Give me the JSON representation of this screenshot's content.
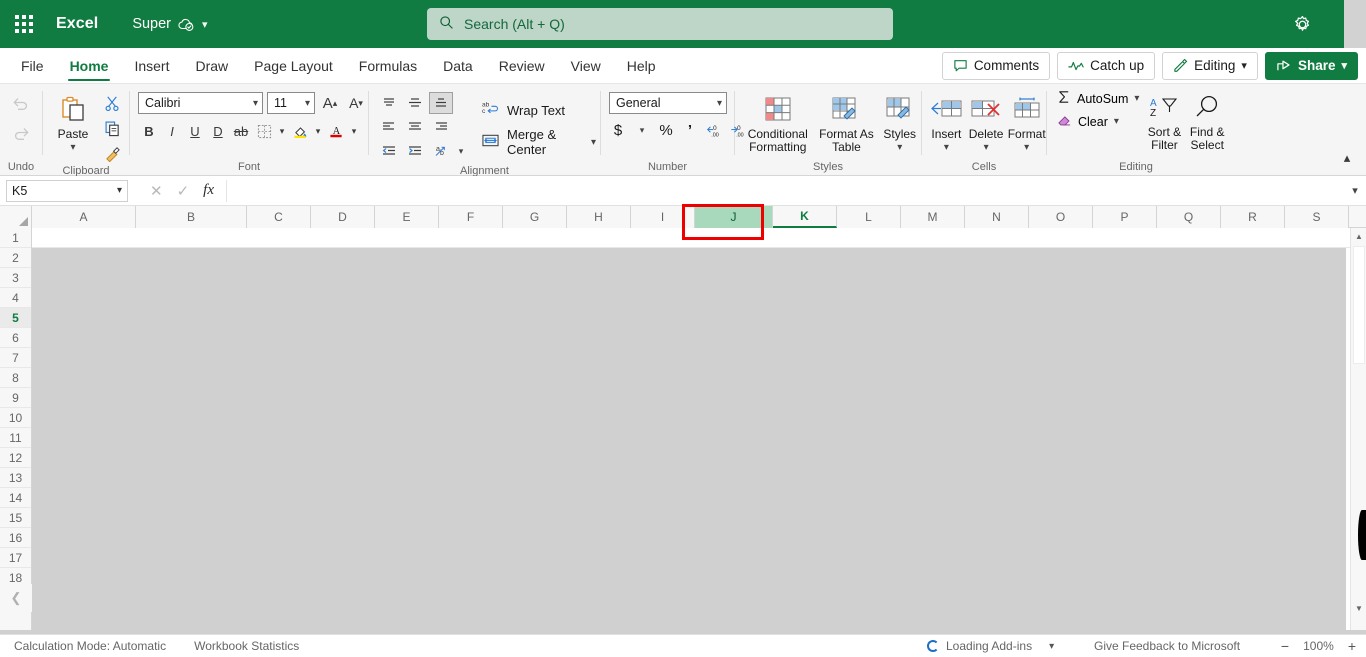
{
  "titlebar": {
    "app_waffle_icon": "app-launcher-icon",
    "app_title": "Excel",
    "doc_name": "Super",
    "cloud_icon": "cloud-saved-icon",
    "doc_chevron": "chevron-down-icon",
    "settings_icon": "gear-icon",
    "brand_color": "#107c41"
  },
  "search": {
    "icon": "search-icon",
    "placeholder": "Search (Alt + Q)"
  },
  "ribbon_tabs": [
    {
      "label": "File",
      "active": false
    },
    {
      "label": "Home",
      "active": true
    },
    {
      "label": "Insert",
      "active": false
    },
    {
      "label": "Draw",
      "active": false
    },
    {
      "label": "Page Layout",
      "active": false
    },
    {
      "label": "Formulas",
      "active": false
    },
    {
      "label": "Data",
      "active": false
    },
    {
      "label": "Review",
      "active": false
    },
    {
      "label": "View",
      "active": false
    },
    {
      "label": "Help",
      "active": false
    }
  ],
  "tabrow_right": {
    "comments": "Comments",
    "comments_icon": "comment-icon",
    "catch_up": "Catch up",
    "catch_up_icon": "activity-line-icon",
    "editing": "Editing",
    "editing_icon": "pencil-icon",
    "editing_chevron": "chevron-down-icon",
    "share": "Share",
    "share_icon": "share-arrow-icon",
    "share_chevron": "chevron-down-icon"
  },
  "ribbon": {
    "groups": [
      {
        "label": "Undo"
      },
      {
        "label": "Clipboard"
      },
      {
        "label": "Font"
      },
      {
        "label": "Alignment"
      },
      {
        "label": "Number"
      },
      {
        "label": "Styles"
      },
      {
        "label": "Cells"
      },
      {
        "label": "Editing"
      }
    ],
    "undo": {
      "undo_icon": "undo-icon",
      "redo_icon": "redo-icon"
    },
    "clipboard": {
      "paste_label": "Paste",
      "paste_icon": "paste-icon",
      "paste_chevron": "chevron-down-icon",
      "cut_icon": "scissors-icon",
      "copy_icon": "copy-icon",
      "format_painter_icon": "format-painter-icon"
    },
    "font": {
      "font_family_value": "Calibri",
      "font_size_value": "11",
      "grow_font_icon": "increase-font-size-icon",
      "shrink_font_icon": "decrease-font-size-icon",
      "bold": "B",
      "italic": "I",
      "underline": "U",
      "double_underline": "D",
      "strikethrough": "ab",
      "borders_icon": "borders-icon",
      "fill_color_icon": "fill-color-icon",
      "font_color_icon": "font-color-icon",
      "fill_color_swatch": "#ffe600",
      "font_color_swatch": "#e00000"
    },
    "alignment": {
      "align_top_icon": "align-top-icon",
      "align_middle_icon": "align-middle-icon",
      "align_bottom_icon": "align-bottom-icon",
      "align_left_icon": "align-left-icon",
      "align_center_icon": "align-center-icon",
      "align_right_icon": "align-right-icon",
      "decrease_indent_icon": "decrease-indent-icon",
      "increase_indent_icon": "increase-indent-icon",
      "orientation_icon": "text-orientation-icon",
      "wrap_text": "Wrap Text",
      "wrap_text_icon": "wrap-text-icon",
      "merge_center": "Merge & Center",
      "merge_center_icon": "merge-cells-icon",
      "merge_chevron": "chevron-down-icon"
    },
    "number": {
      "format_value": "General",
      "currency_icon": "currency-icon",
      "currency_chevron": "chevron-down-icon",
      "percent_icon": "percent-icon",
      "comma_icon": "comma-style-icon",
      "increase_decimal_icon": "increase-decimal-icon",
      "decrease_decimal_icon": "decrease-decimal-icon"
    },
    "styles": {
      "conditional_formatting": "Conditional Formatting",
      "conditional_formatting_icon": "conditional-formatting-icon",
      "format_as_table": "Format As Table",
      "format_as_table_icon": "format-as-table-icon",
      "styles": "Styles",
      "styles_icon": "cell-styles-icon"
    },
    "cells": {
      "insert": "Insert",
      "insert_icon": "insert-cells-icon",
      "delete": "Delete",
      "delete_icon": "delete-cells-icon",
      "format": "Format",
      "format_icon": "format-cells-icon"
    },
    "editing": {
      "autosum": "AutoSum",
      "autosum_icon": "sigma-icon",
      "clear": "Clear",
      "clear_icon": "eraser-icon",
      "sort_filter": "Sort & Filter",
      "sort_filter_icon": "sort-filter-icon",
      "find_select": "Find & Select",
      "find_select_icon": "magnifier-icon",
      "collapse_ribbon_icon": "chevron-up-icon"
    }
  },
  "formula_bar": {
    "name_box_value": "K5",
    "name_box_chevron": "chevron-down-icon",
    "cancel_icon": "close-icon",
    "confirm_icon": "check-icon",
    "function_icon": "fx-icon",
    "formula_value": "",
    "expand_chevron": "chevron-down-icon"
  },
  "grid": {
    "select_all_icon": "select-all-corner-icon",
    "columns": [
      {
        "label": "A",
        "width": 104
      },
      {
        "label": "B",
        "width": 111
      },
      {
        "label": "C",
        "width": 64
      },
      {
        "label": "D",
        "width": 64
      },
      {
        "label": "E",
        "width": 64
      },
      {
        "label": "F",
        "width": 64
      },
      {
        "label": "G",
        "width": 64
      },
      {
        "label": "H",
        "width": 64
      },
      {
        "label": "I",
        "width": 64
      },
      {
        "label": "J",
        "width": 78,
        "hovered": true
      },
      {
        "label": "K",
        "width": 64,
        "current": true
      },
      {
        "label": "L",
        "width": 64
      },
      {
        "label": "M",
        "width": 64
      },
      {
        "label": "N",
        "width": 64
      },
      {
        "label": "O",
        "width": 64
      },
      {
        "label": "P",
        "width": 64
      },
      {
        "label": "Q",
        "width": 64
      },
      {
        "label": "R",
        "width": 64
      },
      {
        "label": "S",
        "width": 64
      }
    ],
    "rows": [
      "1",
      "2",
      "3",
      "4",
      "5",
      "6",
      "7",
      "8",
      "9",
      "10",
      "11",
      "12",
      "13",
      "14",
      "15",
      "16",
      "17",
      "18"
    ],
    "current_row": "5",
    "nav_left_icon": "chevron-left-icon",
    "scroll_up_icon": "scroll-up-arrow-icon",
    "scroll_down_icon": "scroll-down-arrow-icon",
    "highlight_color": "#a8d9bd",
    "annotation_color": "#ee0000"
  },
  "status_bar": {
    "calculation_mode": "Calculation Mode: Automatic",
    "workbook_statistics": "Workbook Statistics",
    "loading_addins": "Loading Add-ins",
    "loading_chevron": "chevron-down-icon",
    "feedback": "Give Feedback to Microsoft",
    "zoom_out_icon": "zoom-out-icon",
    "zoom_level": "100%",
    "zoom_in_icon": "zoom-in-icon"
  }
}
